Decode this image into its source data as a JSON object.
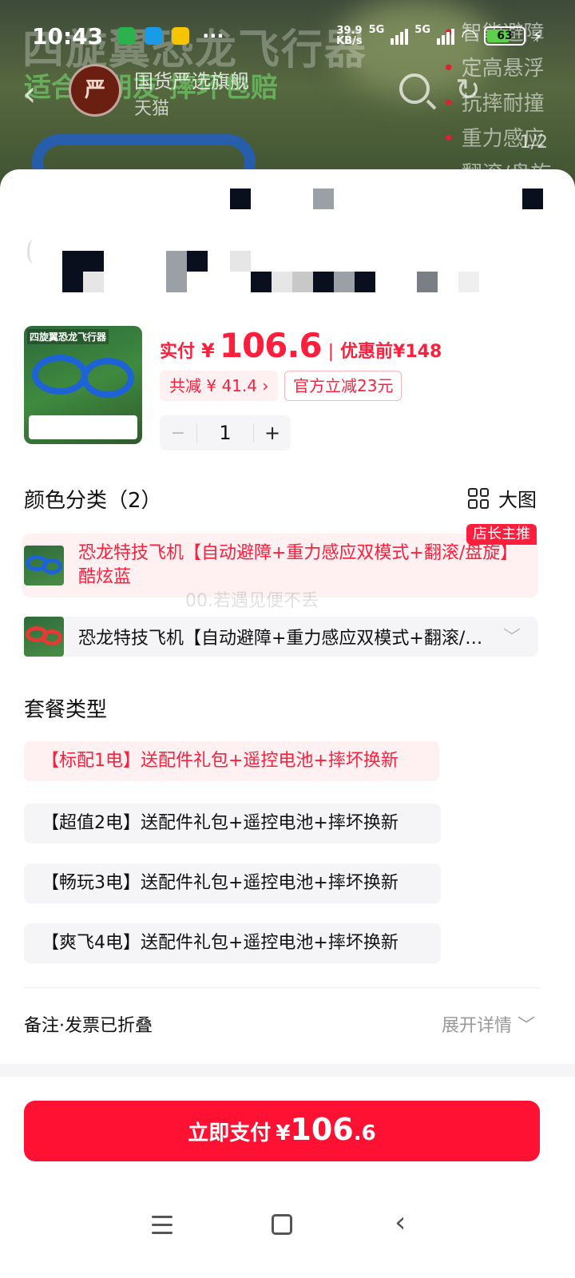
{
  "status_bar": {
    "time": "10:43",
    "speed_value": "39.9",
    "speed_unit": "KB/s",
    "net1": "5G",
    "net2": "5G",
    "battery": "63",
    "more": "···",
    "icons": [
      "wechat-icon",
      "shield-app-icon",
      "meituan-icon",
      "signal-icon",
      "wifi-icon",
      "battery-icon",
      "charging-icon"
    ]
  },
  "header_bg": {
    "title": "四旋翼恐龙飞行器",
    "subtitle": "适合小朋友 摔坏包赔",
    "features": [
      "智能避障",
      "定高悬浮",
      "抗摔耐撞",
      "重力感应",
      "翻滚/盘旋"
    ],
    "pager": "1/2"
  },
  "store": {
    "name": "国货严选旗舰",
    "tag": "天猫",
    "avatar_text": "严"
  },
  "product": {
    "image_title": "四旋翼恐龙飞行器",
    "price_label": "实付",
    "currency": "¥",
    "price": "106.6",
    "separator": "|",
    "original_label": "优惠前",
    "original_price": "¥148",
    "discount_text": "共减 ¥ 41.4 ›",
    "official_text": "官方立减23元",
    "quantity": "1",
    "minus": "−",
    "plus": "+"
  },
  "color_section": {
    "title": "颜色分类（2）",
    "big_view": "大图",
    "options": [
      {
        "label": "恐龙特技飞机【自动避障+重力感应双模式+翻滚/盘旋】酷炫蓝",
        "badge": "店长主推",
        "selected": true
      },
      {
        "label": "恐龙特技飞机【自动避障+重力感应双模式+翻滚/盘旋】...",
        "selected": false
      }
    ],
    "watermark": "00.若遇见便不丢"
  },
  "package_section": {
    "title": "套餐类型",
    "options": [
      {
        "label": "【标配1电】送配件礼包+遥控电池+摔坏换新",
        "selected": true
      },
      {
        "label": "【超值2电】送配件礼包+遥控电池+摔坏换新",
        "selected": false
      },
      {
        "label": "【畅玩3电】送配件礼包+遥控电池+摔坏换新",
        "selected": false
      },
      {
        "label": "【爽飞4电】送配件礼包+遥控电池+摔坏换新",
        "selected": false
      }
    ]
  },
  "notes": {
    "label": "备注·发票已折叠",
    "expand": "展开详情 ﹀"
  },
  "pay": {
    "label": "立即支付",
    "currency": "¥",
    "amount_int": "106",
    "amount_dec": ".6"
  },
  "colors": {
    "accent_red": "#ff1f3d",
    "pay_button": "#ff1133",
    "selected_bg": "#fff0f1",
    "chip_bg": "#f5f5f7"
  }
}
